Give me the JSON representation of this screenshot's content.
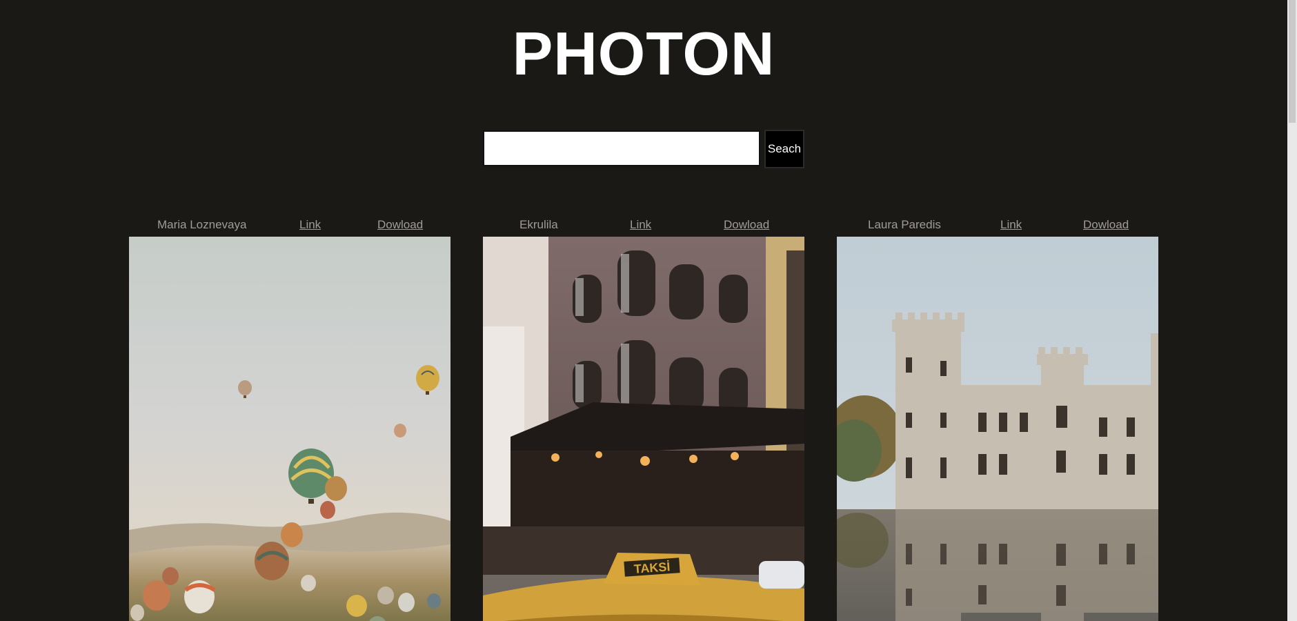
{
  "header": {
    "title": "PHOTON"
  },
  "search": {
    "value": "",
    "placeholder": "",
    "button_label": "Seach"
  },
  "photos": [
    {
      "author": "Maria Loznevaya",
      "link_label": "Link",
      "download_label": "Dowload",
      "subject": "hot-air-balloons-photo"
    },
    {
      "author": "Ekrulila",
      "link_label": "Link",
      "download_label": "Dowload",
      "subject": "city-building-taxi-photo"
    },
    {
      "author": "Laura Paredis",
      "link_label": "Link",
      "download_label": "Dowload",
      "subject": "castle-reflection-photo"
    }
  ],
  "colors": {
    "background": "#1b1916",
    "meta_text": "#a09c97",
    "title": "#ffffff"
  }
}
